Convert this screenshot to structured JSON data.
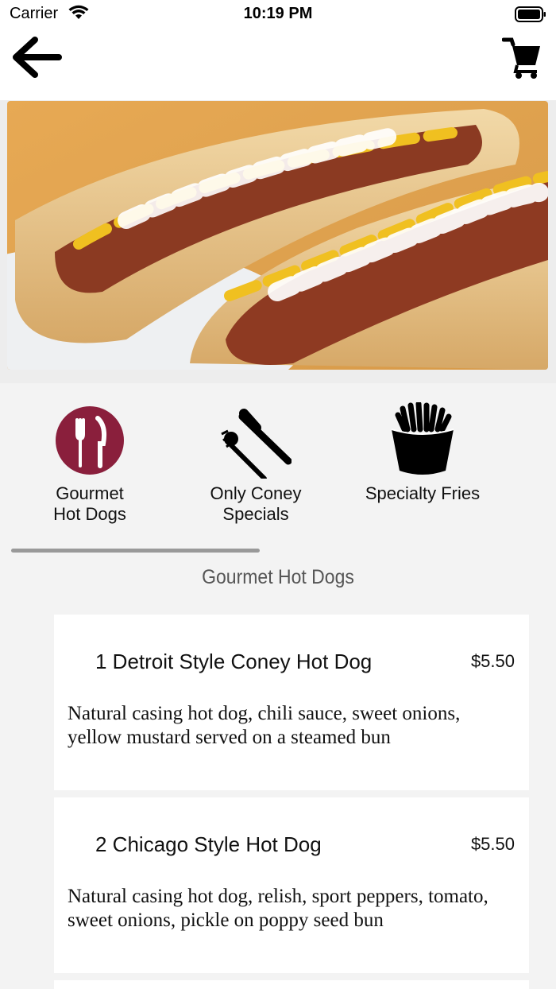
{
  "status": {
    "carrier": "Carrier",
    "time": "10:19 PM"
  },
  "nav": {
    "back_icon": "arrow-left-icon",
    "cart_icon": "cart-icon"
  },
  "hero": {
    "alt": "coney hot dogs photo"
  },
  "categories": [
    {
      "label_line1": "Gourmet",
      "label_line2": "Hot Dogs",
      "icon": "fork-knife-circle-icon",
      "accent": "#8a1f3c"
    },
    {
      "label_line1": "Only Coney",
      "label_line2": "Specials",
      "icon": "fork-knife-icon"
    },
    {
      "label_line1": "Specialty Fries",
      "label_line2": "",
      "icon": "fries-icon"
    }
  ],
  "section": {
    "title": "Gourmet Hot Dogs"
  },
  "items": [
    {
      "name": "1 Detroit Style Coney Hot Dog",
      "price": "$5.50",
      "description": "Natural casing hot dog, chili sauce, sweet onions, yellow mustard served on a steamed bun"
    },
    {
      "name": "2 Chicago Style Hot Dog",
      "price": "$5.50",
      "description": "Natural casing hot dog, relish, sport peppers, tomato, sweet onions, pickle on poppy seed bun"
    }
  ]
}
